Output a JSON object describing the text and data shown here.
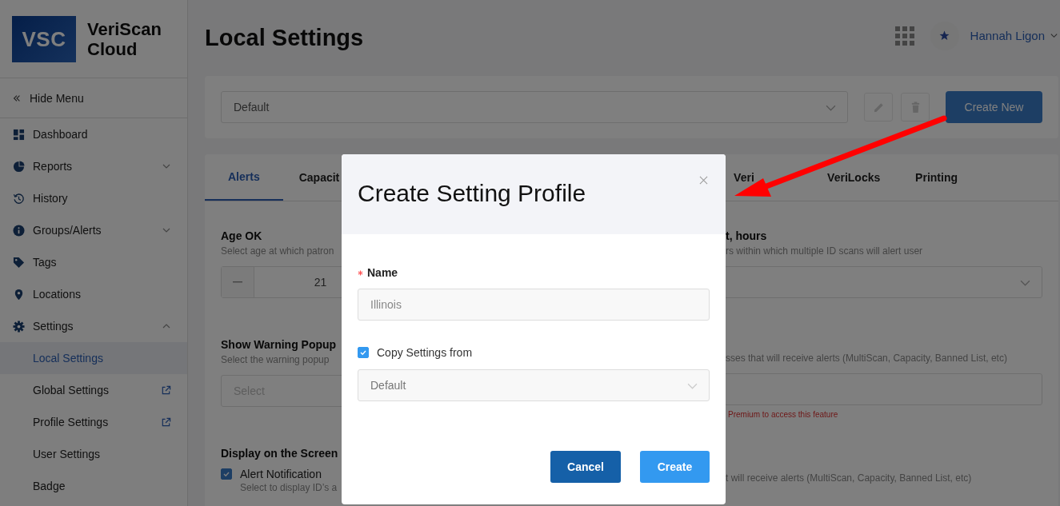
{
  "sidebar": {
    "logo_text": "VSC",
    "brand": "VeriScan Cloud",
    "hide_menu": "Hide Menu",
    "items": [
      {
        "label": "Dashboard",
        "selected": false
      },
      {
        "label": "Reports",
        "selected": false,
        "expanded": false
      },
      {
        "label": "History",
        "selected": false
      },
      {
        "label": "Groups/Alerts",
        "selected": false,
        "expanded": false
      },
      {
        "label": "Tags",
        "selected": false
      },
      {
        "label": "Locations",
        "selected": false
      },
      {
        "label": "Settings",
        "selected": false,
        "expanded": true,
        "children": [
          {
            "label": "Local Settings",
            "selected": true,
            "external": false
          },
          {
            "label": "Global Settings",
            "selected": false,
            "external": true
          },
          {
            "label": "Profile Settings",
            "selected": false,
            "external": true
          },
          {
            "label": "User Settings",
            "selected": false,
            "external": false
          },
          {
            "label": "Badge",
            "selected": false,
            "external": false
          }
        ]
      }
    ]
  },
  "page_title": "Local Settings",
  "user": {
    "name": "Hannah Ligon"
  },
  "profile_bar": {
    "profile": "Default",
    "create_button": "Create New"
  },
  "tabs": [
    {
      "label": "Alerts",
      "selected": true
    },
    {
      "label": "Capacit",
      "selected": false
    },
    {
      "label": "Veri",
      "selected": false
    },
    {
      "label": "VeriLocks",
      "selected": false
    },
    {
      "label": "Printing",
      "selected": false
    }
  ],
  "left_settings": [
    {
      "kind": "stepper",
      "title": "Age OK",
      "description": "Select age at which patron",
      "value": "21"
    },
    {
      "kind": "select",
      "title": "Show Warning Popup",
      "description": "Select the warning popup",
      "placeholder": "Select"
    },
    {
      "kind": "checkbox",
      "title": "Display on the Screen",
      "option": "Alert Notification",
      "checked": true,
      "description": "Select to display ID’s a"
    }
  ],
  "right_settings": [
    {
      "kind": "select",
      "title": "t, hours",
      "description": "rs within which multiple ID scans will alert user"
    },
    {
      "kind": "input",
      "description": "sses that will receive alerts (MultiScan, Capacity, Banned List, etc)",
      "note": "Premium to access this feature"
    },
    {
      "kind": "text",
      "description": "t will receive alerts (MultiScan, Capacity, Banned List, etc)"
    }
  ],
  "dialog": {
    "title": "Create Setting Profile",
    "name_label": "Name",
    "required": true,
    "name_placeholder": "Illinois",
    "copy_label": "Copy Settings from",
    "copy_checked": true,
    "copy_from": "Default",
    "buttons": [
      {
        "label": "Cancel",
        "kind": "secondary"
      },
      {
        "label": "Create",
        "kind": "primary"
      }
    ]
  }
}
